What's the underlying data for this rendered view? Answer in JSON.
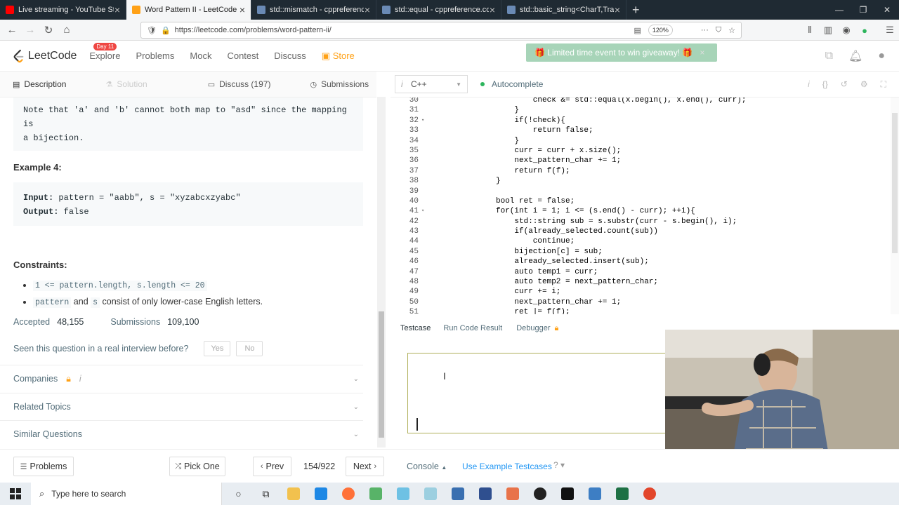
{
  "browser": {
    "tabs": [
      {
        "title": "Live streaming - YouTube Studio",
        "color": "#ff0000",
        "active": false
      },
      {
        "title": "Word Pattern II - LeetCode",
        "color": "#ffa116",
        "active": true
      },
      {
        "title": "std::mismatch - cppreference.c",
        "color": "#6a8ab5",
        "active": false
      },
      {
        "title": "std::equal - cppreference.com",
        "color": "#6a8ab5",
        "active": false
      },
      {
        "title": "std::basic_string<CharT,Traits,A",
        "color": "#6a8ab5",
        "active": false
      }
    ],
    "url": "https://leetcode.com/problems/word-pattern-ii/",
    "zoom": "120%"
  },
  "header": {
    "logo": "LeetCode",
    "menu": [
      "Explore",
      "Problems",
      "Mock",
      "Contest",
      "Discuss"
    ],
    "store": "Store",
    "explore_badge": "Day 11",
    "promo": "🎁 Limited time event to win giveaway! 🎁",
    "promo_close": "×"
  },
  "left_tabs": {
    "description": "Description",
    "solution": "Solution",
    "discuss": "Discuss (197)",
    "submissions": "Submissions"
  },
  "content": {
    "note_line1": "Note that 'a' and 'b' cannot both map to \"asd\" since the mapping is",
    "note_line2": "a bijection.",
    "example_title": "Example 4:",
    "input_label": "Input:",
    "input_value": " pattern = \"aabb\", s = \"xyzabcxzyabc\"",
    "output_label": "Output:",
    "output_value": " false",
    "constraints_title": "Constraints:",
    "constraint1_code": "1 <= pattern.length, s.length <= 20",
    "constraint2_code1": "pattern",
    "constraint2_and": " and ",
    "constraint2_code2": "s",
    "constraint2_rest": " consist of only lower-case English letters."
  },
  "stats": {
    "accepted_label": "Accepted",
    "accepted": "48,155",
    "submissions_label": "Submissions",
    "submissions": "109,100"
  },
  "interview": {
    "question": "Seen this question in a real interview before?",
    "yes": "Yes",
    "no": "No"
  },
  "sections": {
    "companies": "Companies",
    "related": "Related Topics",
    "similar": "Similar Questions"
  },
  "editor": {
    "language": "C++",
    "autocomplete": "Autocomplete",
    "lines": [
      {
        "n": "30",
        "fold": "",
        "indent": 8,
        "text": "check &= std::equal(x.begin(), x.end(), curr);"
      },
      {
        "n": "31",
        "fold": "",
        "indent": 4,
        "text": "}"
      },
      {
        "n": "32",
        "fold": "▾",
        "indent": 4,
        "text": "if(!check){"
      },
      {
        "n": "33",
        "fold": "",
        "indent": 8,
        "text": "return false;"
      },
      {
        "n": "34",
        "fold": "",
        "indent": 4,
        "text": "}"
      },
      {
        "n": "35",
        "fold": "",
        "indent": 4,
        "text": "curr = curr + x.size();"
      },
      {
        "n": "36",
        "fold": "",
        "indent": 4,
        "text": "next_pattern_char += 1;"
      },
      {
        "n": "37",
        "fold": "",
        "indent": 4,
        "text": "return f(f);"
      },
      {
        "n": "38",
        "fold": "",
        "indent": 0,
        "text": "}"
      },
      {
        "n": "39",
        "fold": "",
        "indent": 0,
        "text": ""
      },
      {
        "n": "40",
        "fold": "",
        "indent": 0,
        "text": "bool ret = false;"
      },
      {
        "n": "41",
        "fold": "▾",
        "indent": 0,
        "text": "for(int i = 1; i <= (s.end() - curr); ++i){"
      },
      {
        "n": "42",
        "fold": "",
        "indent": 4,
        "text": "std::string sub = s.substr(curr - s.begin(), i);"
      },
      {
        "n": "43",
        "fold": "",
        "indent": 4,
        "text": "if(already_selected.count(sub))"
      },
      {
        "n": "44",
        "fold": "",
        "indent": 8,
        "text": "continue;"
      },
      {
        "n": "45",
        "fold": "",
        "indent": 4,
        "text": "bijection[c] = sub;"
      },
      {
        "n": "46",
        "fold": "",
        "indent": 4,
        "text": "already_selected.insert(sub);"
      },
      {
        "n": "47",
        "fold": "",
        "indent": 4,
        "text": "auto temp1 = curr;"
      },
      {
        "n": "48",
        "fold": "",
        "indent": 4,
        "text": "auto temp2 = next_pattern_char;"
      },
      {
        "n": "49",
        "fold": "",
        "indent": 4,
        "text": "curr += i;"
      },
      {
        "n": "50",
        "fold": "",
        "indent": 4,
        "text": "next_pattern_char += 1;"
      },
      {
        "n": "51",
        "fold": "",
        "indent": 4,
        "text": "ret |= f(f);"
      }
    ]
  },
  "console_tabs": {
    "testcase": "Testcase",
    "run_result": "Run Code Result",
    "debugger": "Debugger"
  },
  "footer": {
    "problems": "Problems",
    "pick_one": "Pick One",
    "prev": "Prev",
    "page": "154/922",
    "next": "Next",
    "console": "Console",
    "use_example": "Use Example Testcases"
  },
  "taskbar": {
    "search_placeholder": "Type here to search"
  }
}
